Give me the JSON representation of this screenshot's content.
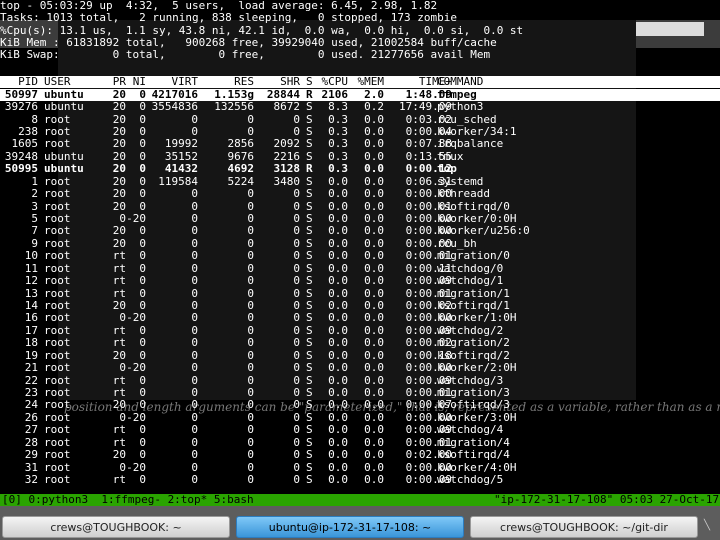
{
  "summary": {
    "line1": "top - 05:03:29 up  4:32,  5 users,  load average: 6.45, 2.98, 1.82",
    "line2": "Tasks: 1013 total,   2 running, 838 sleeping,   0 stopped, 173 zombie",
    "line3": "%Cpu(s): 13.1 us,  1.1 sy, 43.8 ni, 42.1 id,  0.0 wa,  0.0 hi,  0.0 si,  0.0 st",
    "line4": "KiB Mem : 61831892 total,   900268 free, 39929040 used, 21002584 buff/cache",
    "line5": "KiB Swap:        0 total,        0 free,        0 used. 21277656 avail Mem"
  },
  "columns": [
    "PID",
    "USER",
    "PR",
    "NI",
    "VIRT",
    "RES",
    "SHR",
    "S",
    "%CPU",
    "%MEM",
    "TIME+",
    "COMMAND"
  ],
  "processes": [
    {
      "pid": "50997",
      "user": "ubuntu",
      "pr": "20",
      "ni": "0",
      "virt": "4217016",
      "res": "1.153g",
      "shr": "28844",
      "s": "R",
      "cpu": "2106",
      "mem": "2.0",
      "time": "1:48.09",
      "cmd": "ffmpeg",
      "style": "hl"
    },
    {
      "pid": "39276",
      "user": "ubuntu",
      "pr": "20",
      "ni": "0",
      "virt": "3554836",
      "res": "132556",
      "shr": "8672",
      "s": "S",
      "cpu": "8.3",
      "mem": "0.2",
      "time": "17:49.09",
      "cmd": "python3",
      "style": ""
    },
    {
      "pid": "8",
      "user": "root",
      "pr": "20",
      "ni": "0",
      "virt": "0",
      "res": "0",
      "shr": "0",
      "s": "S",
      "cpu": "0.3",
      "mem": "0.0",
      "time": "0:03.02",
      "cmd": "rcu_sched",
      "style": ""
    },
    {
      "pid": "238",
      "user": "root",
      "pr": "20",
      "ni": "0",
      "virt": "0",
      "res": "0",
      "shr": "0",
      "s": "S",
      "cpu": "0.3",
      "mem": "0.0",
      "time": "0:00.04",
      "cmd": "kworker/34:1",
      "style": ""
    },
    {
      "pid": "1605",
      "user": "root",
      "pr": "20",
      "ni": "0",
      "virt": "19992",
      "res": "2856",
      "shr": "2092",
      "s": "S",
      "cpu": "0.3",
      "mem": "0.0",
      "time": "0:07.88",
      "cmd": "irqbalance",
      "style": ""
    },
    {
      "pid": "39248",
      "user": "ubuntu",
      "pr": "20",
      "ni": "0",
      "virt": "35152",
      "res": "9676",
      "shr": "2216",
      "s": "S",
      "cpu": "0.3",
      "mem": "0.0",
      "time": "0:13.55",
      "cmd": "tmux",
      "style": ""
    },
    {
      "pid": "50995",
      "user": "ubuntu",
      "pr": "20",
      "ni": "0",
      "virt": "41432",
      "res": "4692",
      "shr": "3128",
      "s": "R",
      "cpu": "0.3",
      "mem": "0.0",
      "time": "0:00.12",
      "cmd": "top",
      "style": "run"
    },
    {
      "pid": "1",
      "user": "root",
      "pr": "20",
      "ni": "0",
      "virt": "119584",
      "res": "5224",
      "shr": "3480",
      "s": "S",
      "cpu": "0.0",
      "mem": "0.0",
      "time": "0:06.31",
      "cmd": "systemd",
      "style": ""
    },
    {
      "pid": "2",
      "user": "root",
      "pr": "20",
      "ni": "0",
      "virt": "0",
      "res": "0",
      "shr": "0",
      "s": "S",
      "cpu": "0.0",
      "mem": "0.0",
      "time": "0:00.00",
      "cmd": "kthreadd",
      "style": ""
    },
    {
      "pid": "3",
      "user": "root",
      "pr": "20",
      "ni": "0",
      "virt": "0",
      "res": "0",
      "shr": "0",
      "s": "S",
      "cpu": "0.0",
      "mem": "0.0",
      "time": "0:00.01",
      "cmd": "ksoftirqd/0",
      "style": ""
    },
    {
      "pid": "5",
      "user": "root",
      "pr": "0",
      "ni": "-20",
      "virt": "0",
      "res": "0",
      "shr": "0",
      "s": "S",
      "cpu": "0.0",
      "mem": "0.0",
      "time": "0:00.00",
      "cmd": "kworker/0:0H",
      "style": ""
    },
    {
      "pid": "7",
      "user": "root",
      "pr": "20",
      "ni": "0",
      "virt": "0",
      "res": "0",
      "shr": "0",
      "s": "S",
      "cpu": "0.0",
      "mem": "0.0",
      "time": "0:00.00",
      "cmd": "kworker/u256:0",
      "style": ""
    },
    {
      "pid": "9",
      "user": "root",
      "pr": "20",
      "ni": "0",
      "virt": "0",
      "res": "0",
      "shr": "0",
      "s": "S",
      "cpu": "0.0",
      "mem": "0.0",
      "time": "0:00.00",
      "cmd": "rcu_bh",
      "style": ""
    },
    {
      "pid": "10",
      "user": "root",
      "pr": "rt",
      "ni": "0",
      "virt": "0",
      "res": "0",
      "shr": "0",
      "s": "S",
      "cpu": "0.0",
      "mem": "0.0",
      "time": "0:00.01",
      "cmd": "migration/0",
      "style": ""
    },
    {
      "pid": "11",
      "user": "root",
      "pr": "rt",
      "ni": "0",
      "virt": "0",
      "res": "0",
      "shr": "0",
      "s": "S",
      "cpu": "0.0",
      "mem": "0.0",
      "time": "0:00.11",
      "cmd": "watchdog/0",
      "style": ""
    },
    {
      "pid": "12",
      "user": "root",
      "pr": "rt",
      "ni": "0",
      "virt": "0",
      "res": "0",
      "shr": "0",
      "s": "S",
      "cpu": "0.0",
      "mem": "0.0",
      "time": "0:00.09",
      "cmd": "watchdog/1",
      "style": ""
    },
    {
      "pid": "13",
      "user": "root",
      "pr": "rt",
      "ni": "0",
      "virt": "0",
      "res": "0",
      "shr": "0",
      "s": "S",
      "cpu": "0.0",
      "mem": "0.0",
      "time": "0:00.01",
      "cmd": "migration/1",
      "style": ""
    },
    {
      "pid": "14",
      "user": "root",
      "pr": "20",
      "ni": "0",
      "virt": "0",
      "res": "0",
      "shr": "0",
      "s": "S",
      "cpu": "0.0",
      "mem": "0.0",
      "time": "0:00.02",
      "cmd": "ksoftirqd/1",
      "style": ""
    },
    {
      "pid": "16",
      "user": "root",
      "pr": "0",
      "ni": "-20",
      "virt": "0",
      "res": "0",
      "shr": "0",
      "s": "S",
      "cpu": "0.0",
      "mem": "0.0",
      "time": "0:00.00",
      "cmd": "kworker/1:0H",
      "style": ""
    },
    {
      "pid": "17",
      "user": "root",
      "pr": "rt",
      "ni": "0",
      "virt": "0",
      "res": "0",
      "shr": "0",
      "s": "S",
      "cpu": "0.0",
      "mem": "0.0",
      "time": "0:00.09",
      "cmd": "watchdog/2",
      "style": ""
    },
    {
      "pid": "18",
      "user": "root",
      "pr": "rt",
      "ni": "0",
      "virt": "0",
      "res": "0",
      "shr": "0",
      "s": "S",
      "cpu": "0.0",
      "mem": "0.0",
      "time": "0:00.02",
      "cmd": "migration/2",
      "style": ""
    },
    {
      "pid": "19",
      "user": "root",
      "pr": "20",
      "ni": "0",
      "virt": "0",
      "res": "0",
      "shr": "0",
      "s": "S",
      "cpu": "0.0",
      "mem": "0.0",
      "time": "0:00.18",
      "cmd": "ksoftirqd/2",
      "style": ""
    },
    {
      "pid": "21",
      "user": "root",
      "pr": "0",
      "ni": "-20",
      "virt": "0",
      "res": "0",
      "shr": "0",
      "s": "S",
      "cpu": "0.0",
      "mem": "0.0",
      "time": "0:00.00",
      "cmd": "kworker/2:0H",
      "style": ""
    },
    {
      "pid": "22",
      "user": "root",
      "pr": "rt",
      "ni": "0",
      "virt": "0",
      "res": "0",
      "shr": "0",
      "s": "S",
      "cpu": "0.0",
      "mem": "0.0",
      "time": "0:00.09",
      "cmd": "watchdog/3",
      "style": ""
    },
    {
      "pid": "23",
      "user": "root",
      "pr": "rt",
      "ni": "0",
      "virt": "0",
      "res": "0",
      "shr": "0",
      "s": "S",
      "cpu": "0.0",
      "mem": "0.0",
      "time": "0:00.01",
      "cmd": "migration/3",
      "style": ""
    },
    {
      "pid": "24",
      "user": "root",
      "pr": "20",
      "ni": "0",
      "virt": "0",
      "res": "0",
      "shr": "0",
      "s": "S",
      "cpu": "0.0",
      "mem": "0.0",
      "time": "0:00.07",
      "cmd": "ksoftirqd/3",
      "style": ""
    },
    {
      "pid": "26",
      "user": "root",
      "pr": "0",
      "ni": "-20",
      "virt": "0",
      "res": "0",
      "shr": "0",
      "s": "S",
      "cpu": "0.0",
      "mem": "0.0",
      "time": "0:00.00",
      "cmd": "kworker/3:0H",
      "style": ""
    },
    {
      "pid": "27",
      "user": "root",
      "pr": "rt",
      "ni": "0",
      "virt": "0",
      "res": "0",
      "shr": "0",
      "s": "S",
      "cpu": "0.0",
      "mem": "0.0",
      "time": "0:00.09",
      "cmd": "watchdog/4",
      "style": ""
    },
    {
      "pid": "28",
      "user": "root",
      "pr": "rt",
      "ni": "0",
      "virt": "0",
      "res": "0",
      "shr": "0",
      "s": "S",
      "cpu": "0.0",
      "mem": "0.0",
      "time": "0:00.01",
      "cmd": "migration/4",
      "style": ""
    },
    {
      "pid": "29",
      "user": "root",
      "pr": "20",
      "ni": "0",
      "virt": "0",
      "res": "0",
      "shr": "0",
      "s": "S",
      "cpu": "0.0",
      "mem": "0.0",
      "time": "0:02.00",
      "cmd": "ksoftirqd/4",
      "style": ""
    },
    {
      "pid": "31",
      "user": "root",
      "pr": "0",
      "ni": "-20",
      "virt": "0",
      "res": "0",
      "shr": "0",
      "s": "S",
      "cpu": "0.0",
      "mem": "0.0",
      "time": "0:00.00",
      "cmd": "kworker/4:0H",
      "style": ""
    },
    {
      "pid": "32",
      "user": "root",
      "pr": "rt",
      "ni": "0",
      "virt": "0",
      "res": "0",
      "shr": "0",
      "s": "S",
      "cpu": "0.0",
      "mem": "0.0",
      "time": "0:00.09",
      "cmd": "watchdog/5",
      "style": ""
    }
  ],
  "tmux": {
    "windows": "[0] 0:python3  1:ffmpeg- 2:top* 5:bash",
    "right": "\"ip-172-31-17-108\" 05:03 27-Oct-17"
  },
  "taskbar": {
    "tasks": [
      "crews@TOUGHBOOK: ~",
      "ubuntu@ip-172-31-17-108: ~",
      "crews@TOUGHBOOK: ~/git-dir"
    ],
    "active_index": 1
  },
  "background_text": "position and length arguments can be \"parameterized,\" that is, represented as a variable, rather than as a numerical constant."
}
